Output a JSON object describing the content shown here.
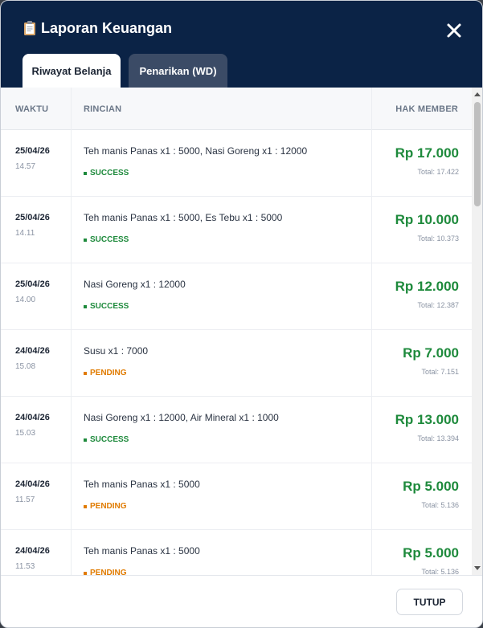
{
  "header": {
    "title": "Laporan Keuangan",
    "title_icon": "clipboard-icon",
    "close_icon": "close-icon"
  },
  "tabs": [
    {
      "label": "Riwayat Belanja",
      "active": true
    },
    {
      "label": "Penarikan (WD)",
      "active": false
    }
  ],
  "table": {
    "headers": {
      "waktu": "WAKTU",
      "rincian": "RINCIAN",
      "hak_member": "HAK MEMBER"
    },
    "rows": [
      {
        "date": "25/04/26",
        "time": "14.57",
        "desc": "Teh manis Panas x1 : 5000, Nasi Goreng x1 : 12000",
        "status": "SUCCESS",
        "amount": "Rp 17.000",
        "total": "Total: 17.422"
      },
      {
        "date": "25/04/26",
        "time": "14.11",
        "desc": "Teh manis Panas x1 : 5000, Es Tebu x1 : 5000",
        "status": "SUCCESS",
        "amount": "Rp 10.000",
        "total": "Total: 10.373"
      },
      {
        "date": "25/04/26",
        "time": "14.00",
        "desc": "Nasi Goreng x1 : 12000",
        "status": "SUCCESS",
        "amount": "Rp 12.000",
        "total": "Total: 12.387"
      },
      {
        "date": "24/04/26",
        "time": "15.08",
        "desc": "Susu x1 : 7000",
        "status": "PENDING",
        "amount": "Rp 7.000",
        "total": "Total: 7.151"
      },
      {
        "date": "24/04/26",
        "time": "15.03",
        "desc": "Nasi Goreng x1 : 12000, Air Mineral x1 : 1000",
        "status": "SUCCESS",
        "amount": "Rp 13.000",
        "total": "Total: 13.394"
      },
      {
        "date": "24/04/26",
        "time": "11.57",
        "desc": "Teh manis Panas x1 : 5000",
        "status": "PENDING",
        "amount": "Rp 5.000",
        "total": "Total: 5.136"
      },
      {
        "date": "24/04/26",
        "time": "11.53",
        "desc": "Teh manis Panas x1 : 5000",
        "status": "PENDING",
        "amount": "Rp 5.000",
        "total": "Total: 5.136"
      }
    ]
  },
  "footer": {
    "close_label": "TUTUP"
  },
  "colors": {
    "header_bg": "#0b2346",
    "success": "#1e8a3c",
    "pending": "#e07b00",
    "amount": "#1e8a3c"
  }
}
